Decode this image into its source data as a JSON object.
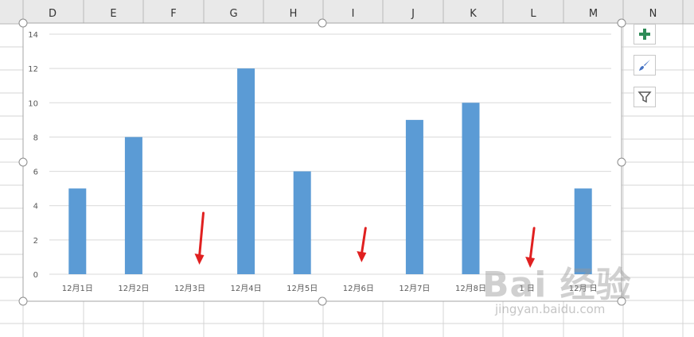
{
  "sheet": {
    "columns": [
      "D",
      "E",
      "F",
      "G",
      "H",
      "I",
      "J",
      "K",
      "L",
      "M",
      "N"
    ]
  },
  "chart_data": {
    "type": "bar",
    "categories": [
      "12月1日",
      "12月2日",
      "12月3日",
      "12月4日",
      "12月5日",
      "12月6日",
      "12月7日",
      "12月8日",
      "1 日",
      "12月 日"
    ],
    "values": [
      5,
      8,
      null,
      12,
      6,
      null,
      9,
      10,
      null,
      5
    ],
    "title": "",
    "xlabel": "",
    "ylabel": "",
    "ylim": [
      0,
      14
    ],
    "yticks": [
      0,
      2,
      4,
      6,
      8,
      10,
      12,
      14
    ],
    "grid": true,
    "bar_color": "#5B9BD5",
    "annotations": [
      {
        "type": "arrow",
        "target_category": "12月3日",
        "color": "#E02020"
      },
      {
        "type": "arrow",
        "target_category": "12月6日",
        "color": "#E02020"
      },
      {
        "type": "arrow",
        "target_category": "1 日",
        "color": "#E02020"
      }
    ]
  },
  "chart_buttons": [
    {
      "name": "chart-elements-button",
      "icon": "plus-icon",
      "color": "#2E8B57"
    },
    {
      "name": "chart-styles-button",
      "icon": "brush-icon",
      "color": "#4472C4"
    },
    {
      "name": "chart-filters-button",
      "icon": "filter-icon",
      "color": "#595959"
    }
  ],
  "watermark": {
    "main": "Bai 经验",
    "sub": "jingyan.baidu.com"
  }
}
